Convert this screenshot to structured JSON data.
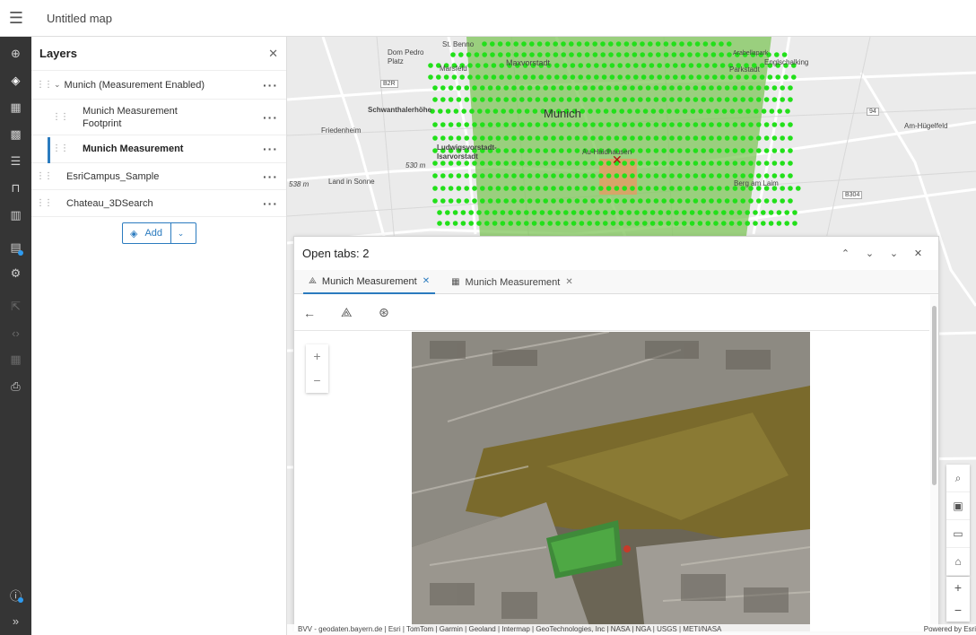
{
  "header": {
    "title": "Untitled map"
  },
  "rail": {
    "items": [
      {
        "icon": "add-icon"
      },
      {
        "icon": "layers-icon"
      },
      {
        "icon": "table-icon"
      },
      {
        "icon": "basemap-icon"
      },
      {
        "icon": "legend-icon"
      },
      {
        "icon": "bookmark-icon"
      },
      {
        "icon": "chart-icon"
      },
      {
        "icon": "tabs-icon"
      },
      {
        "icon": "settings-icon"
      },
      {
        "icon": "share-icon"
      },
      {
        "icon": "embed-icon"
      },
      {
        "icon": "apps-icon"
      },
      {
        "icon": "print-icon"
      },
      {
        "icon": "info-icon"
      },
      {
        "icon": "expand-icon"
      }
    ]
  },
  "layers_panel": {
    "title": "Layers",
    "layers": [
      {
        "label": "Munich (Measurement Enabled)"
      },
      {
        "label": "Munich Measurement\nFootprint"
      },
      {
        "label": "Munich Measurement"
      },
      {
        "label": "EsriCampus_Sample"
      },
      {
        "label": "Chateau_3DSearch"
      }
    ],
    "add_label": "Add"
  },
  "map": {
    "labels": [
      {
        "text": "St. Benno"
      },
      {
        "text": "Dom Pedro\nPlatz"
      },
      {
        "text": "Marsfeld"
      },
      {
        "text": "Maxvorstadt"
      },
      {
        "text": "Arabellapark"
      },
      {
        "text": "Parkstadt"
      },
      {
        "text": "Englschalking"
      },
      {
        "text": "B2R"
      },
      {
        "text": "Schwanthalerhöhe"
      },
      {
        "text": "Munich"
      },
      {
        "text": "94"
      },
      {
        "text": "Friedenheim"
      },
      {
        "text": "Am-Hügelfeld"
      },
      {
        "text": "Ludwigsvorstadt-\nIsarvorstadt"
      },
      {
        "text": "Au-Haidhausen"
      },
      {
        "text": "530 m"
      },
      {
        "text": "538 m"
      },
      {
        "text": "Land in Sonne"
      },
      {
        "text": "Berg am Laim"
      },
      {
        "text": "B304"
      }
    ],
    "attribution": "BVV - geodaten.bayern.de | Esri | TomTom | Garmin | Geoland | Intermap | GeoTechnologies, Inc | NASA | NGA | USGS | METI/NASA",
    "powered": "Powered by Esri"
  },
  "popup": {
    "title": "Open tabs: 2",
    "tabs": [
      {
        "label": "Munich Measurement",
        "icon": "measure-icon",
        "active": true
      },
      {
        "label": "Munich Measurement",
        "icon": "table-icon",
        "active": false
      }
    ]
  },
  "colors": {
    "accent": "#2b7bbf",
    "point": "#22e01a",
    "area": "#8fcf6a",
    "selection": "#e08a5a"
  }
}
